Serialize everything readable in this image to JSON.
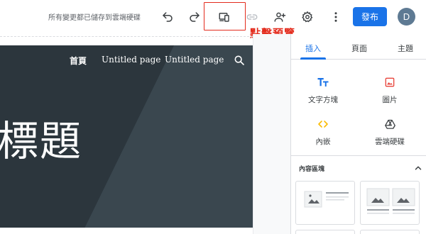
{
  "toolbar": {
    "save_status": "所有變更都已儲存到雲端硬碟",
    "publish_label": "發布",
    "avatar_initial": "D",
    "icons": [
      "undo-icon",
      "redo-icon",
      "preview-icon",
      "link-icon",
      "share-add-person-icon",
      "settings-gear-icon",
      "more-vert-icon"
    ]
  },
  "annotation": {
    "callout_text": "點擊預覽",
    "color": "#e32b1c"
  },
  "site": {
    "nav": {
      "home": "首頁",
      "page1": "Untitled page",
      "page2": "Untitled page"
    },
    "hero_title": "標題"
  },
  "panel": {
    "tabs": {
      "insert": "插入",
      "pages": "頁面",
      "themes": "主題"
    },
    "insert_items": {
      "textbox": "文字方塊",
      "image": "圖片",
      "embed": "內嵌",
      "drive": "雲端硬碟"
    },
    "section_title": "內容區塊"
  },
  "colors": {
    "accent_blue": "#1a73e8",
    "image_red": "#e8453c",
    "embed_yellow": "#fbbc04",
    "hero_bg": "#2f3a41",
    "avatar_bg": "#5e7a93"
  }
}
